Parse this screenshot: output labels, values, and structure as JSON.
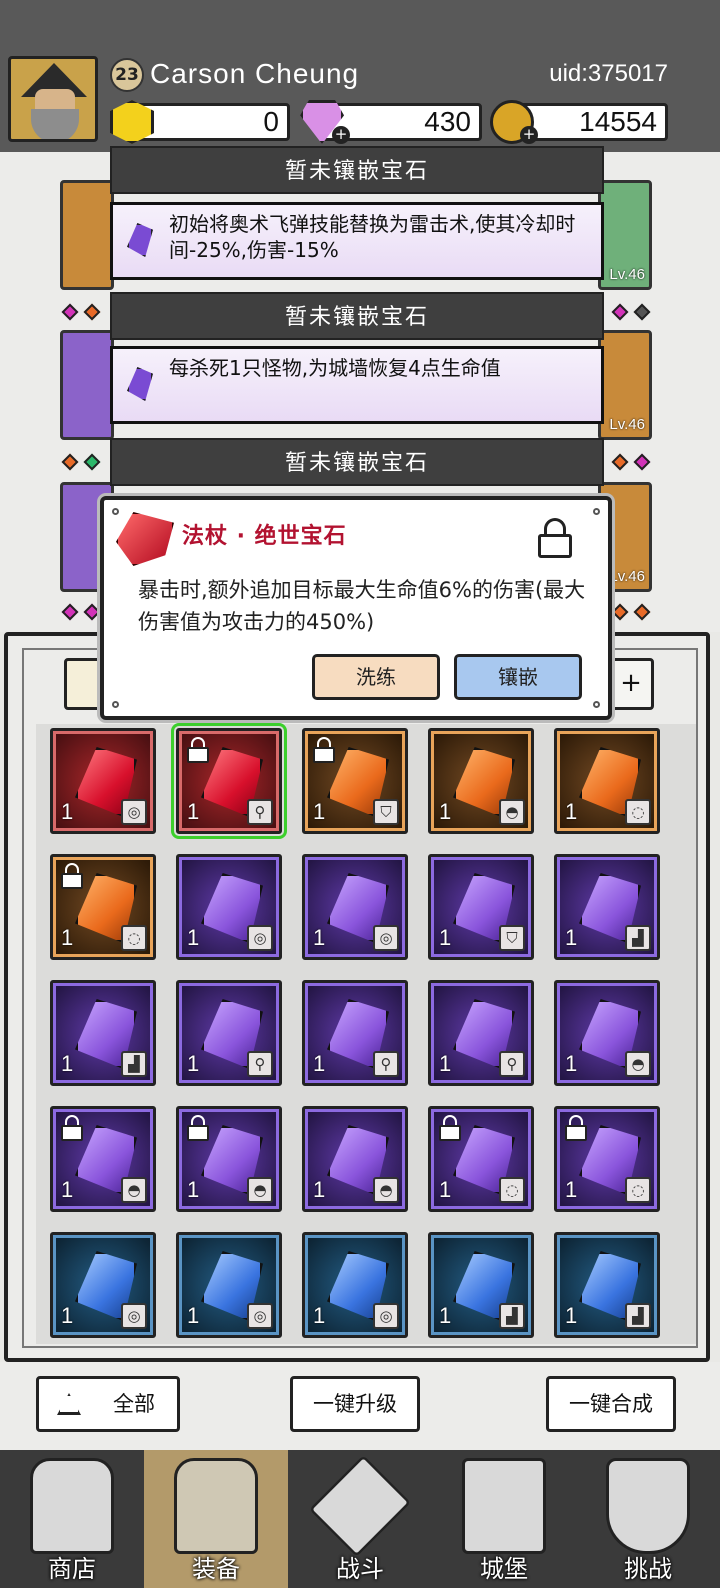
{
  "player": {
    "level": "23",
    "name": "Carson  Cheung",
    "uid": "uid:375017"
  },
  "currency": {
    "gems": "0",
    "diamonds": "430",
    "coins": "14554"
  },
  "slots": [
    {
      "header": "暂未镶嵌宝石",
      "desc": "初始将奥术飞弹技能替换为雷击术,使其冷却时间-25%,伤害-15%"
    },
    {
      "header": "暂未镶嵌宝石",
      "desc": "每杀死1只怪物,为城墙恢复4点生命值"
    },
    {
      "header": "暂未镶嵌宝石"
    }
  ],
  "side_levels": [
    "Lv.46",
    "Lv.46",
    "Lv.46"
  ],
  "popup": {
    "title": "法杖 · 绝世宝石",
    "desc": "暴击时,额外追加目标最大生命值6%的伤害(最大伤害值为攻击力的450%)",
    "refine_label": "洗练",
    "inlay_label": "镶嵌"
  },
  "inventory": [
    [
      {
        "color": "red",
        "count": "1",
        "type": "ring",
        "locked": false
      },
      {
        "color": "red",
        "count": "1",
        "type": "staff",
        "locked": true,
        "selected": true
      },
      {
        "color": "orange",
        "count": "1",
        "type": "armor",
        "locked": true
      },
      {
        "color": "orange",
        "count": "1",
        "type": "hat",
        "locked": false
      },
      {
        "color": "orange",
        "count": "1",
        "type": "necklace",
        "locked": false
      }
    ],
    [
      {
        "color": "orange",
        "count": "1",
        "type": "necklace",
        "locked": true
      },
      {
        "color": "purple",
        "count": "1",
        "type": "ring",
        "locked": false
      },
      {
        "color": "purple",
        "count": "1",
        "type": "ring",
        "locked": false
      },
      {
        "color": "purple",
        "count": "1",
        "type": "armor",
        "locked": false
      },
      {
        "color": "purple",
        "count": "1",
        "type": "boots",
        "locked": false
      }
    ],
    [
      {
        "color": "purple",
        "count": "1",
        "type": "boots",
        "locked": false
      },
      {
        "color": "purple",
        "count": "1",
        "type": "staff",
        "locked": false
      },
      {
        "color": "purple",
        "count": "1",
        "type": "staff",
        "locked": false
      },
      {
        "color": "purple",
        "count": "1",
        "type": "staff",
        "locked": false
      },
      {
        "color": "purple",
        "count": "1",
        "type": "hat",
        "locked": false
      }
    ],
    [
      {
        "color": "purple",
        "count": "1",
        "type": "hat",
        "locked": true
      },
      {
        "color": "purple",
        "count": "1",
        "type": "hat",
        "locked": true
      },
      {
        "color": "purple",
        "count": "1",
        "type": "hat",
        "locked": false
      },
      {
        "color": "purple",
        "count": "1",
        "type": "necklace",
        "locked": true
      },
      {
        "color": "purple",
        "count": "1",
        "type": "necklace",
        "locked": true
      }
    ],
    [
      {
        "color": "blue",
        "count": "1",
        "type": "ring",
        "locked": false
      },
      {
        "color": "blue",
        "count": "1",
        "type": "ring",
        "locked": false
      },
      {
        "color": "blue",
        "count": "1",
        "type": "ring",
        "locked": false
      },
      {
        "color": "blue",
        "count": "1",
        "type": "boots",
        "locked": false
      },
      {
        "color": "blue",
        "count": "1",
        "type": "boots",
        "locked": false
      }
    ]
  ],
  "actions": {
    "all_label": "全部",
    "upgrade_label": "一键升级",
    "merge_label": "一键合成"
  },
  "nav": [
    {
      "label": "商店",
      "icon": "shop-icon"
    },
    {
      "label": "装备",
      "icon": "backpack-icon",
      "active": true
    },
    {
      "label": "战斗",
      "icon": "swords-icon"
    },
    {
      "label": "城堡",
      "icon": "castle-icon"
    },
    {
      "label": "挑战",
      "icon": "shield-icon"
    }
  ],
  "colors": {
    "header_bg": "#595959",
    "popup_title": "#b21230",
    "selected_outline": "#3ccf2c"
  }
}
